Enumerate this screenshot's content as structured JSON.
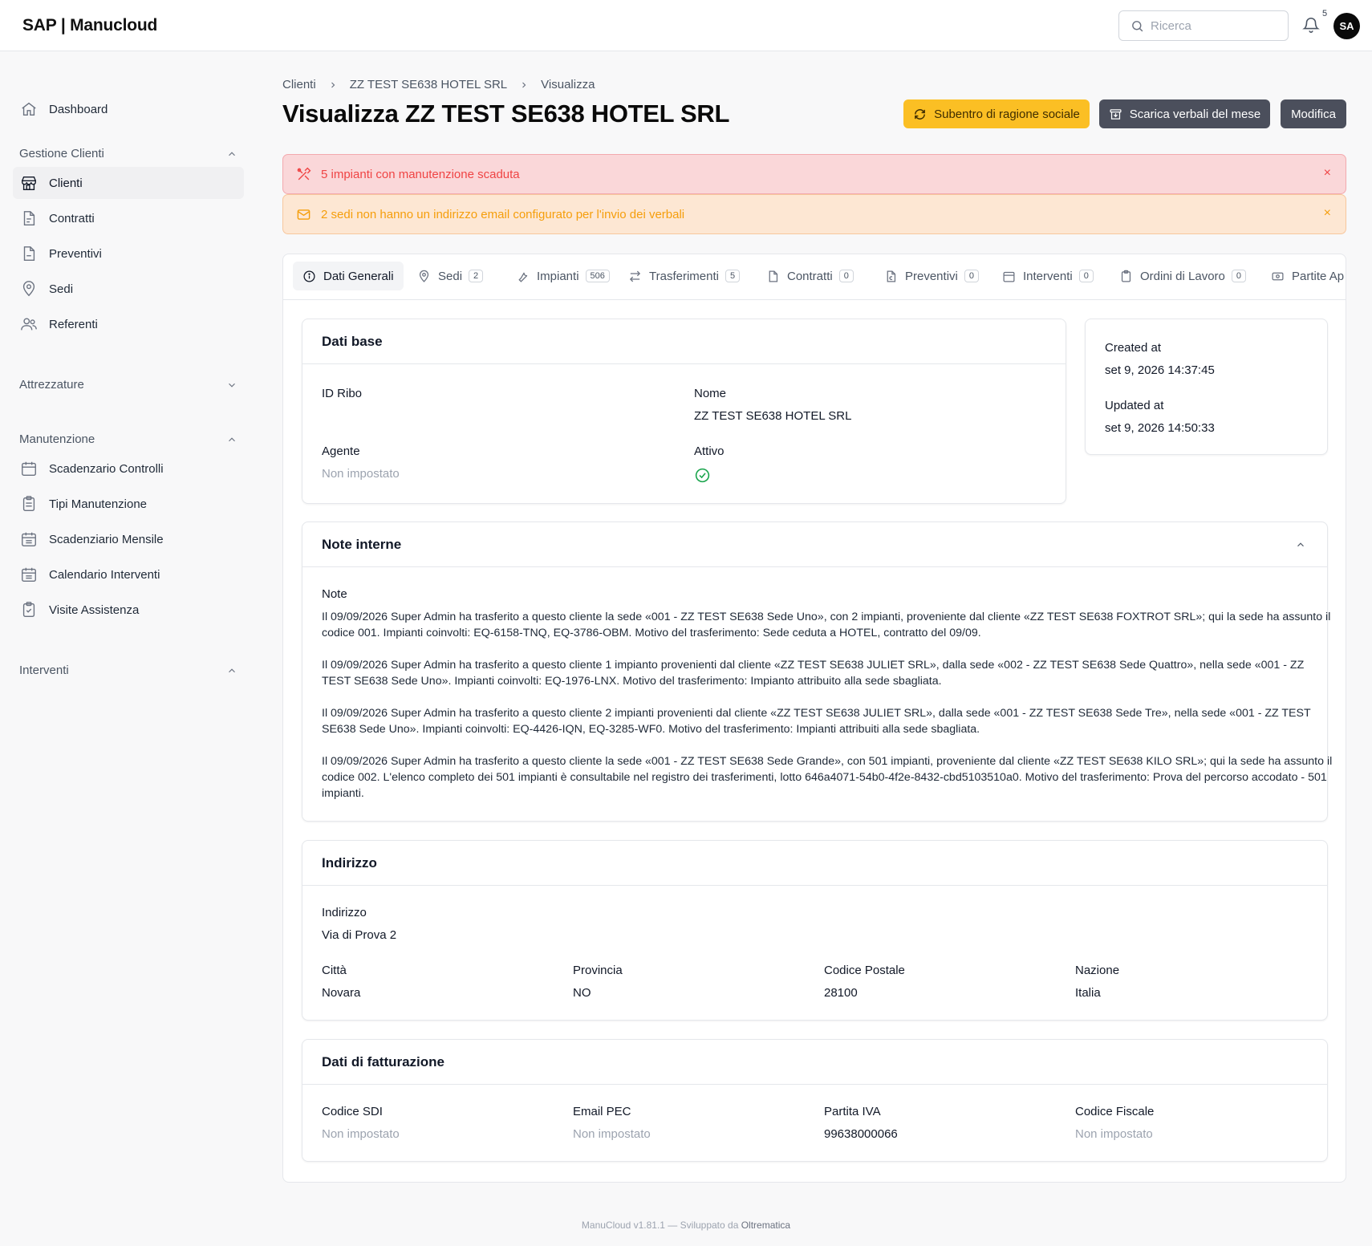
{
  "app": {
    "logo": "SAP | Manucloud"
  },
  "topbar": {
    "search_placeholder": "Ricerca",
    "notifications_count": "5",
    "avatar_initials": "SA"
  },
  "sidebar": {
    "dashboard": "Dashboard",
    "sections": [
      {
        "label": "Gestione Clienti",
        "items": [
          "Clienti",
          "Contratti",
          "Preventivi",
          "Sedi",
          "Referenti"
        ]
      },
      {
        "label": "Attrezzature",
        "items": []
      },
      {
        "label": "Manutenzione",
        "items": [
          "Scadenzario Controlli",
          "Tipi Manutenzione",
          "Scadenziario Mensile",
          "Calendario Interventi",
          "Visite Assistenza"
        ]
      },
      {
        "label": "Interventi",
        "items": []
      }
    ]
  },
  "breadcrumb": [
    "Clienti",
    "ZZ TEST SE638 HOTEL SRL",
    "Visualizza"
  ],
  "page": {
    "title": "Visualizza ZZ TEST SE638 HOTEL SRL"
  },
  "actions": {
    "subentro": "Subentro di ragione sociale",
    "scarica": "Scarica verbali del mese",
    "modifica": "Modifica"
  },
  "alerts": {
    "maintenance": "5 impianti con manutenzione scaduta",
    "email": "2 sedi non hanno un indirizzo email configurato per l'invio dei verbali",
    "close": "×"
  },
  "tabs": [
    {
      "label": "Dati Generali",
      "count": ""
    },
    {
      "label": "Sedi",
      "count": "2"
    },
    {
      "label": "Impianti",
      "count": "506"
    },
    {
      "label": "Trasferimenti",
      "count": "5"
    },
    {
      "label": "Contratti",
      "count": "0"
    },
    {
      "label": "Preventivi",
      "count": "0"
    },
    {
      "label": "Interventi",
      "count": "0"
    },
    {
      "label": "Ordini di Lavoro",
      "count": "0"
    },
    {
      "label": "Partite Ap",
      "count": ""
    }
  ],
  "dati_base": {
    "title": "Dati base",
    "id_ribo_label": "ID Ribo",
    "id_ribo": "",
    "nome_label": "Nome",
    "nome": "ZZ TEST SE638 HOTEL SRL",
    "agente_label": "Agente",
    "agente": "Non impostato",
    "attivo_label": "Attivo"
  },
  "meta": {
    "created_label": "Created at",
    "created": "set 9, 2026 14:37:45",
    "updated_label": "Updated at",
    "updated": "set 9, 2026 14:50:33"
  },
  "note_interne": {
    "title": "Note interne",
    "label": "Note",
    "paragraphs": [
      "Il 09/09/2026 Super Admin ha trasferito a questo cliente la sede «001 - ZZ TEST SE638 Sede Uno», con 2 impianti, proveniente dal cliente «ZZ TEST SE638 FOXTROT SRL»; qui la sede ha assunto il codice 001. Impianti coinvolti: EQ-6158-TNQ, EQ-3786-OBM. Motivo del trasferimento: Sede ceduta a HOTEL, contratto del 09/09.",
      "Il 09/09/2026 Super Admin ha trasferito a questo cliente 1 impianto provenienti dal cliente «ZZ TEST SE638 JULIET SRL», dalla sede «002 - ZZ TEST SE638 Sede Quattro», nella sede «001 - ZZ TEST SE638 Sede Uno». Impianti coinvolti: EQ-1976-LNX. Motivo del trasferimento: Impianto attribuito alla sede sbagliata.",
      "Il 09/09/2026 Super Admin ha trasferito a questo cliente 2 impianti provenienti dal cliente «ZZ TEST SE638 JULIET SRL», dalla sede «001 - ZZ TEST SE638 Sede Tre», nella sede «001 - ZZ TEST SE638 Sede Uno». Impianti coinvolti: EQ-4426-IQN, EQ-3285-WF0. Motivo del trasferimento: Impianti attribuiti alla sede sbagliata.",
      "Il 09/09/2026 Super Admin ha trasferito a questo cliente la sede «001 - ZZ TEST SE638 Sede Grande», con 501 impianti, proveniente dal cliente «ZZ TEST SE638 KILO SRL»; qui la sede ha assunto il codice 002. L'elenco completo dei 501 impianti è consultabile nel registro dei trasferimenti, lotto 646a4071-54b0-4f2e-8432-cbd5103510a0. Motivo del trasferimento: Prova del percorso accodato - 501 impianti."
    ]
  },
  "indirizzo": {
    "title": "Indirizzo",
    "indirizzo_label": "Indirizzo",
    "indirizzo": "Via di Prova 2",
    "citta_label": "Città",
    "citta": "Novara",
    "provincia_label": "Provincia",
    "provincia": "NO",
    "cap_label": "Codice Postale",
    "cap": "28100",
    "nazione_label": "Nazione",
    "nazione": "Italia"
  },
  "fatturazione": {
    "title": "Dati di fatturazione",
    "sdi_label": "Codice SDI",
    "sdi": "Non impostato",
    "pec_label": "Email PEC",
    "pec": "Non impostato",
    "piva_label": "Partita IVA",
    "piva": "99638000066",
    "cf_label": "Codice Fiscale",
    "cf": "Non impostato"
  },
  "footer": {
    "version": "ManuCloud v1.81.1 — Sviluppato da",
    "brand": "Oltrematica"
  },
  "colors": {
    "accent_yellow": "#fbbf24",
    "dark_button": "#4b4f5c",
    "alert_red_bg": "#fad7d9",
    "alert_orange_bg": "#fde7d3",
    "active_green": "#16a34a"
  }
}
